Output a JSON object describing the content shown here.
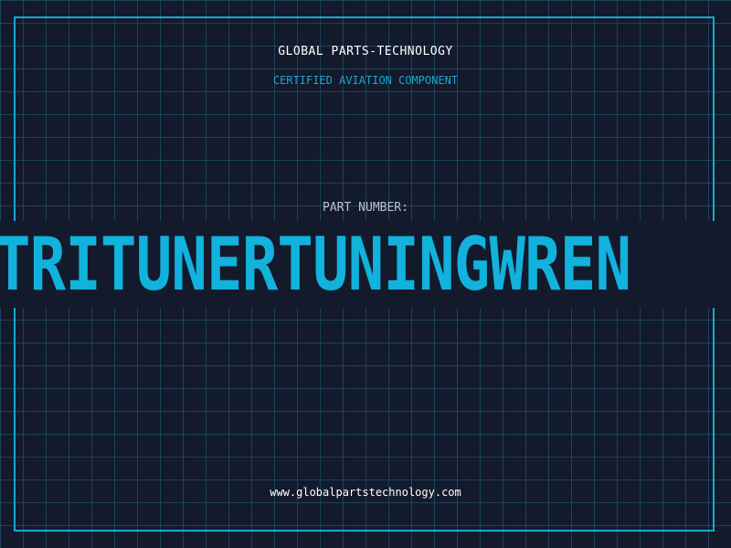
{
  "header": {
    "company": "GLOBAL PARTS-TECHNOLOGY",
    "tagline": "CERTIFIED AVIATION COMPONENT"
  },
  "part": {
    "label": "PART NUMBER:",
    "number": "TRITUNERTUNINGWREN"
  },
  "footer": {
    "url": "www.globalpartstechnology.com"
  },
  "colors": {
    "background": "#121a2c",
    "grid": "#246280",
    "accent": "#11b2dc",
    "frame": "#1aa7cf",
    "text_primary": "#ffffff",
    "text_muted": "#b8c3d2"
  }
}
